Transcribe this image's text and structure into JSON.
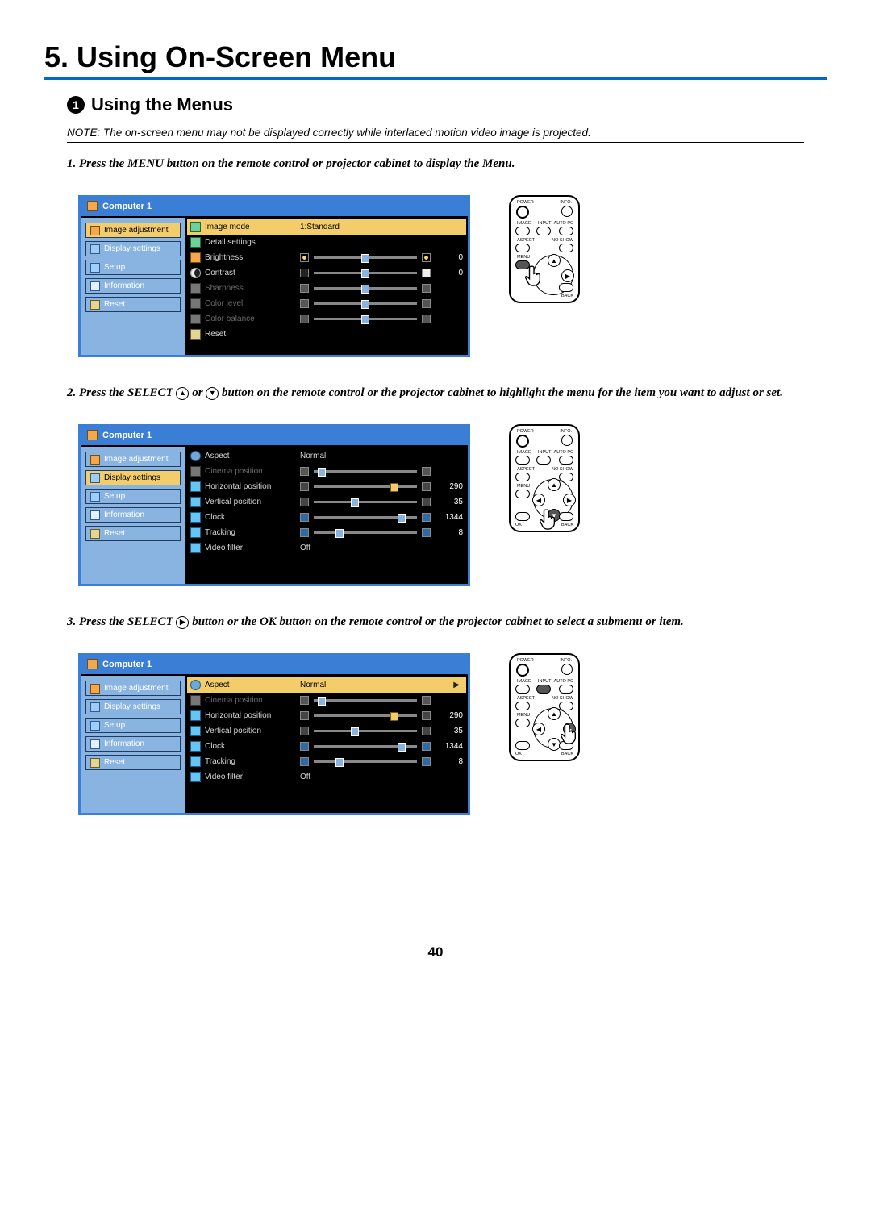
{
  "chapter_title": "5. Using On-Screen Menu",
  "section_number": "1",
  "section_title": "Using the Menus",
  "note_prefix": "NOTE: ",
  "note_text": "The on-screen menu may not be displayed correctly while interlaced motion video image is projected.",
  "step1": "1.  Press the MENU button on the remote control or projector cabinet to display the Menu.",
  "step2_a": "2.  Press the SELECT ",
  "step2_b": " or ",
  "step2_c": " button on the remote control or the projector cabinet to highlight the menu for the item you want to adjust or set.",
  "step3_a": "3.  Press the SELECT ",
  "step3_b": " button or the OK button on the remote control or the projector cabinet to select a submenu or item.",
  "page_number": "40",
  "remote_labels": {
    "power": "POWER",
    "info": "INFO.",
    "image": "IMAGE",
    "input": "INPUT",
    "autopc": "AUTO PC",
    "aspect": "ASPECT",
    "noshow": "NO SHOW",
    "menu": "MENU",
    "ok": "OK",
    "back": "BACK"
  },
  "osd_common": {
    "header": "Computer 1",
    "side": {
      "image_adjustment": "Image adjustment",
      "display_settings": "Display settings",
      "setup": "Setup",
      "information": "Information",
      "reset": "Reset"
    }
  },
  "osd1": {
    "image_mode": {
      "label": "Image mode",
      "value": "1:Standard"
    },
    "detail_settings": {
      "label": "Detail settings"
    },
    "brightness": {
      "label": "Brightness",
      "num": "0",
      "pos": 50
    },
    "contrast": {
      "label": "Contrast",
      "num": "0",
      "pos": 50
    },
    "sharpness": {
      "label": "Sharpness",
      "pos": 50
    },
    "color_level": {
      "label": "Color level",
      "pos": 50
    },
    "color_balance": {
      "label": "Color balance",
      "pos": 50
    },
    "reset": {
      "label": "Reset"
    }
  },
  "osd2": {
    "aspect": {
      "label": "Aspect",
      "value": "Normal"
    },
    "cinema_position": {
      "label": "Cinema position",
      "pos": 8
    },
    "horizontal": {
      "label": "Horizontal position",
      "num": "290",
      "pos": 78
    },
    "vertical": {
      "label": "Vertical position",
      "num": "35",
      "pos": 40
    },
    "clock": {
      "label": "Clock",
      "num": "1344",
      "pos": 85
    },
    "tracking": {
      "label": "Tracking",
      "num": "8",
      "pos": 25
    },
    "video_filter": {
      "label": "Video filter",
      "value": "Off"
    }
  },
  "osd3": {
    "aspect": {
      "label": "Aspect",
      "value": "Normal"
    },
    "cinema_position": {
      "label": "Cinema position",
      "pos": 8
    },
    "horizontal": {
      "label": "Horizontal position",
      "num": "290",
      "pos": 78
    },
    "vertical": {
      "label": "Vertical position",
      "num": "35",
      "pos": 40
    },
    "clock": {
      "label": "Clock",
      "num": "1344",
      "pos": 85
    },
    "tracking": {
      "label": "Tracking",
      "num": "8",
      "pos": 25
    },
    "video_filter": {
      "label": "Video filter",
      "value": "Off"
    }
  }
}
